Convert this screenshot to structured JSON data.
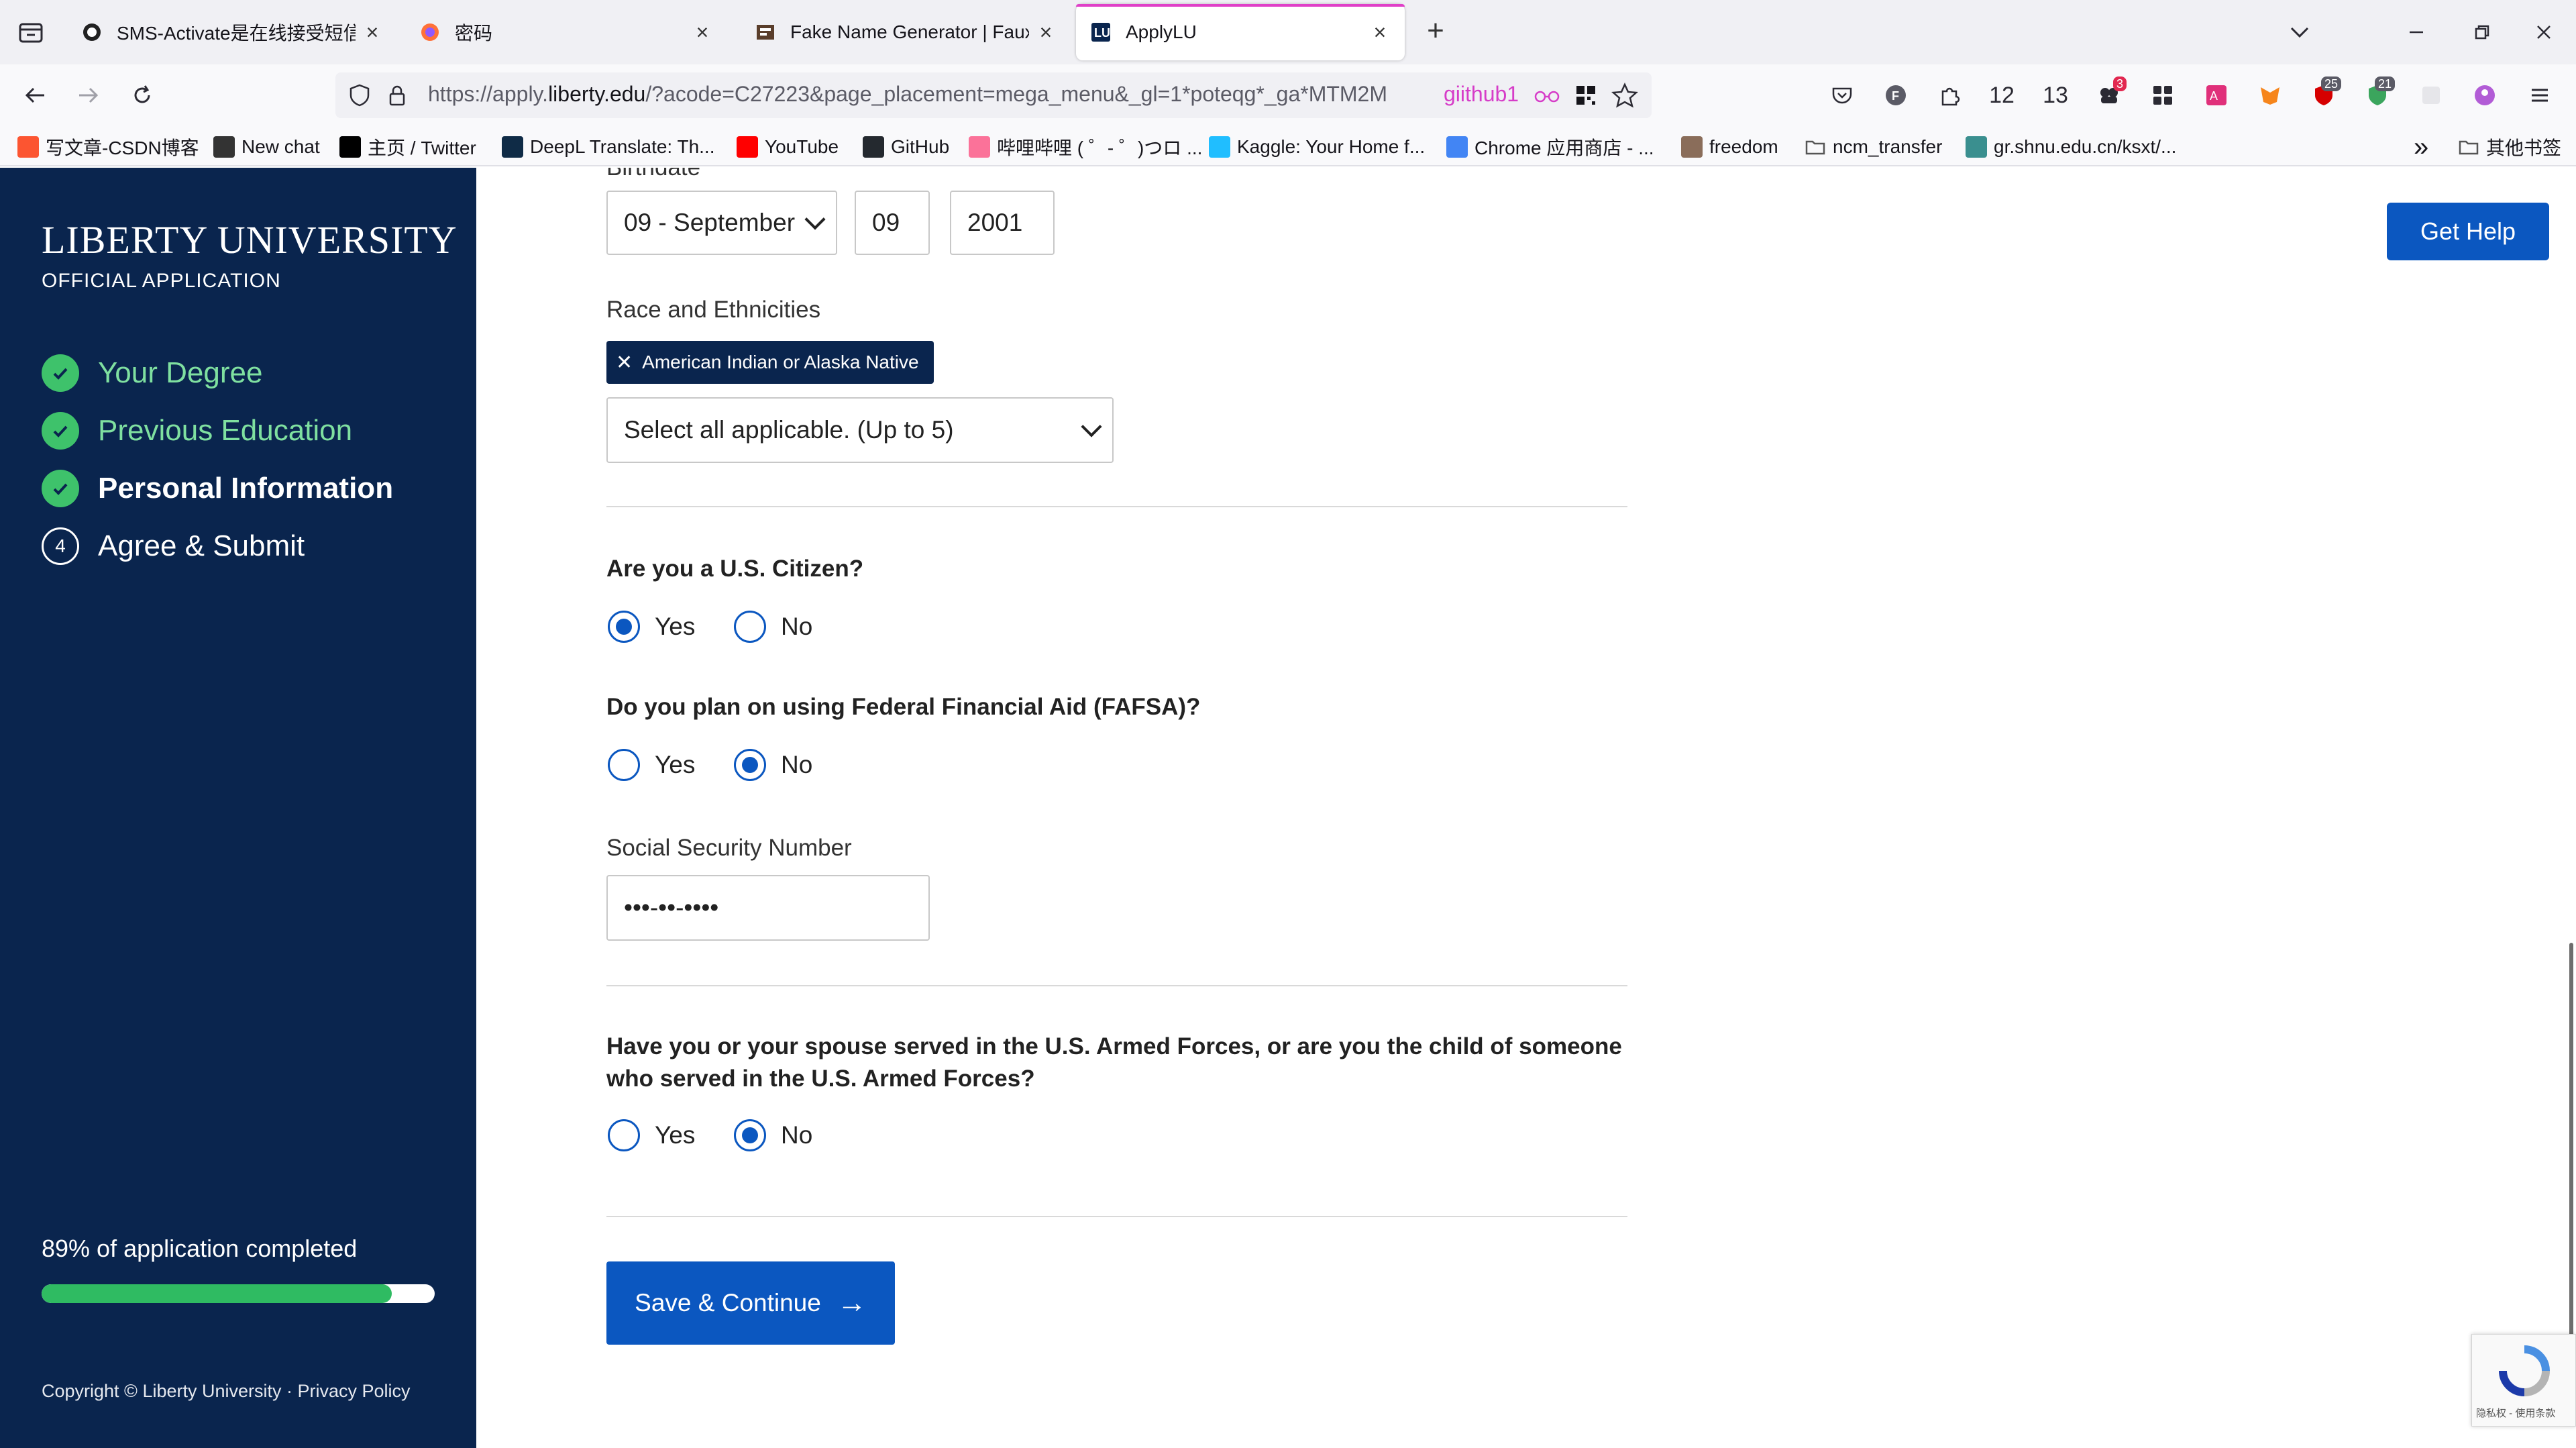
{
  "browser": {
    "tabs": [
      {
        "title": "SMS-Activate是在线接受短信的服务",
        "active": false
      },
      {
        "title": "密码",
        "active": false
      },
      {
        "title": "Fake Name Generator | FauxID",
        "active": false
      },
      {
        "title": "ApplyLU",
        "active": true
      }
    ],
    "url_prefix": "https://apply.",
    "url_domain": "liberty.edu",
    "url_rest": "/?acode=C27223&page_placement=mega_menu&_gl=1*poteqg*_ga*MTM2M",
    "extension_label": "giithub1",
    "toolbar_counters": [
      "12",
      "13"
    ],
    "toolbar_badges": [
      "3",
      "25",
      "21"
    ],
    "bookmarks": [
      {
        "label": "写文章-CSDN博客",
        "icon": "csdn-icon",
        "color": "#fc5531"
      },
      {
        "label": "New chat",
        "icon": "openai-icon",
        "color": "#333333"
      },
      {
        "label": "主页 / Twitter",
        "icon": "x-icon",
        "color": "#000000"
      },
      {
        "label": "DeepL Translate: Th...",
        "icon": "deepl-icon",
        "color": "#0f2b46"
      },
      {
        "label": "YouTube",
        "icon": "youtube-icon",
        "color": "#ff0000"
      },
      {
        "label": "GitHub",
        "icon": "github-icon",
        "color": "#24292f"
      },
      {
        "label": "哔哩哔哩 ( ゜- ゜)つロ ...",
        "icon": "bilibili-icon",
        "color": "#fb7299"
      },
      {
        "label": "Kaggle: Your Home f...",
        "icon": "kaggle-icon",
        "color": "#20beff"
      },
      {
        "label": "Chrome 应用商店 - ...",
        "icon": "chrome-store-icon",
        "color": "#4285f4"
      },
      {
        "label": "freedom",
        "icon": "freedom-icon",
        "color": "#8a6d5a"
      },
      {
        "label": "ncm_transfer",
        "icon": "folder-icon",
        "color": "#555555"
      },
      {
        "label": "gr.shnu.edu.cn/ksxt/...",
        "icon": "shnu-icon",
        "color": "#3a8f8f"
      }
    ],
    "other_bookmarks": "其他书签"
  },
  "sidebar": {
    "logo": "LIBERTY UNIVERSITY",
    "subtitle": "OFFICIAL APPLICATION",
    "steps": [
      {
        "label": "Your Degree",
        "state": "complete"
      },
      {
        "label": "Previous Education",
        "state": "complete"
      },
      {
        "label": "Personal Information",
        "state": "current"
      },
      {
        "label": "Agree & Submit",
        "state": "pending",
        "number": "4"
      }
    ],
    "progress_text": "89% of application completed",
    "progress_value": 0.89,
    "copyright": "Copyright © Liberty University · Privacy Policy"
  },
  "form": {
    "help_button": "Get Help",
    "birthdate_label": "Birthdate",
    "birth_month": "09 - September",
    "birth_day": "09",
    "birth_year": "2001",
    "race_label": "Race and Ethnicities",
    "race_chip": "American Indian or Alaska Native",
    "race_placeholder": "Select all applicable. (Up to 5)",
    "citizen_question": "Are you a U.S. Citizen?",
    "citizen_answer": "Yes",
    "fafsa_question": "Do you plan on using Federal Financial Aid (FAFSA)?",
    "fafsa_answer": "No",
    "ssn_label": "Social Security Number",
    "ssn_value": "•••-••-••••",
    "military_question": "Have you or your spouse served in the U.S. Armed Forces, or are you the child of someone who served in the U.S. Armed Forces?",
    "military_answer": "No",
    "yes_label": "Yes",
    "no_label": "No",
    "save_button": "Save & Continue",
    "recaptcha_text": "隐私权 - 使用条款"
  },
  "colors": {
    "sidebar_bg": "#0a254e",
    "accent_blue": "#0b57c0",
    "complete_green": "#3ec26b",
    "progress_green": "#2fbb62"
  }
}
